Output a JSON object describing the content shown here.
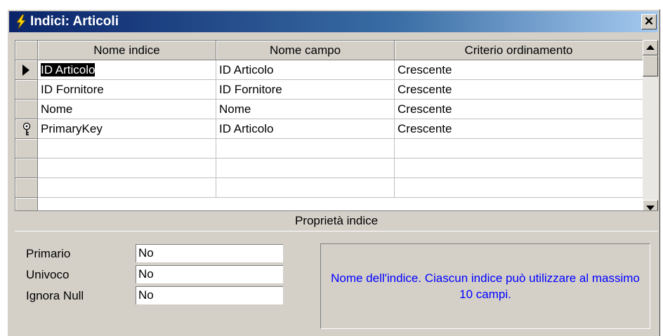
{
  "window": {
    "title": "Indici: Articoli",
    "close_glyph": "✕"
  },
  "grid": {
    "columns": [
      "Nome indice",
      "Nome campo",
      "Criterio ordinamento"
    ],
    "rows": [
      {
        "indicator": "current-row-arrow-icon",
        "name": "ID Articolo",
        "field": "ID Articolo",
        "order": "Crescente"
      },
      {
        "indicator": "",
        "name": "ID Fornitore",
        "field": "ID Fornitore",
        "order": "Crescente"
      },
      {
        "indicator": "",
        "name": "Nome",
        "field": "Nome",
        "order": "Crescente"
      },
      {
        "indicator": "primary-key-icon",
        "name": "PrimaryKey",
        "field": "ID Articolo",
        "order": "Crescente"
      },
      {
        "indicator": "",
        "name": "",
        "field": "",
        "order": ""
      },
      {
        "indicator": "",
        "name": "",
        "field": "",
        "order": ""
      },
      {
        "indicator": "",
        "name": "",
        "field": "",
        "order": ""
      }
    ]
  },
  "properties": {
    "header": "Proprietà indice",
    "fields": [
      {
        "label": "Primario",
        "value": "No"
      },
      {
        "label": "Univoco",
        "value": "No"
      },
      {
        "label": "Ignora Null",
        "value": "No"
      }
    ],
    "help": "Nome dell'indice. Ciascun indice può utilizzare al massimo 10 campi."
  },
  "colors": {
    "title_gradient_start": "#0a246a",
    "title_gradient_end": "#a6caf0",
    "face": "#d4d0c8",
    "help_text": "#0000ff",
    "selection": "#000000"
  }
}
